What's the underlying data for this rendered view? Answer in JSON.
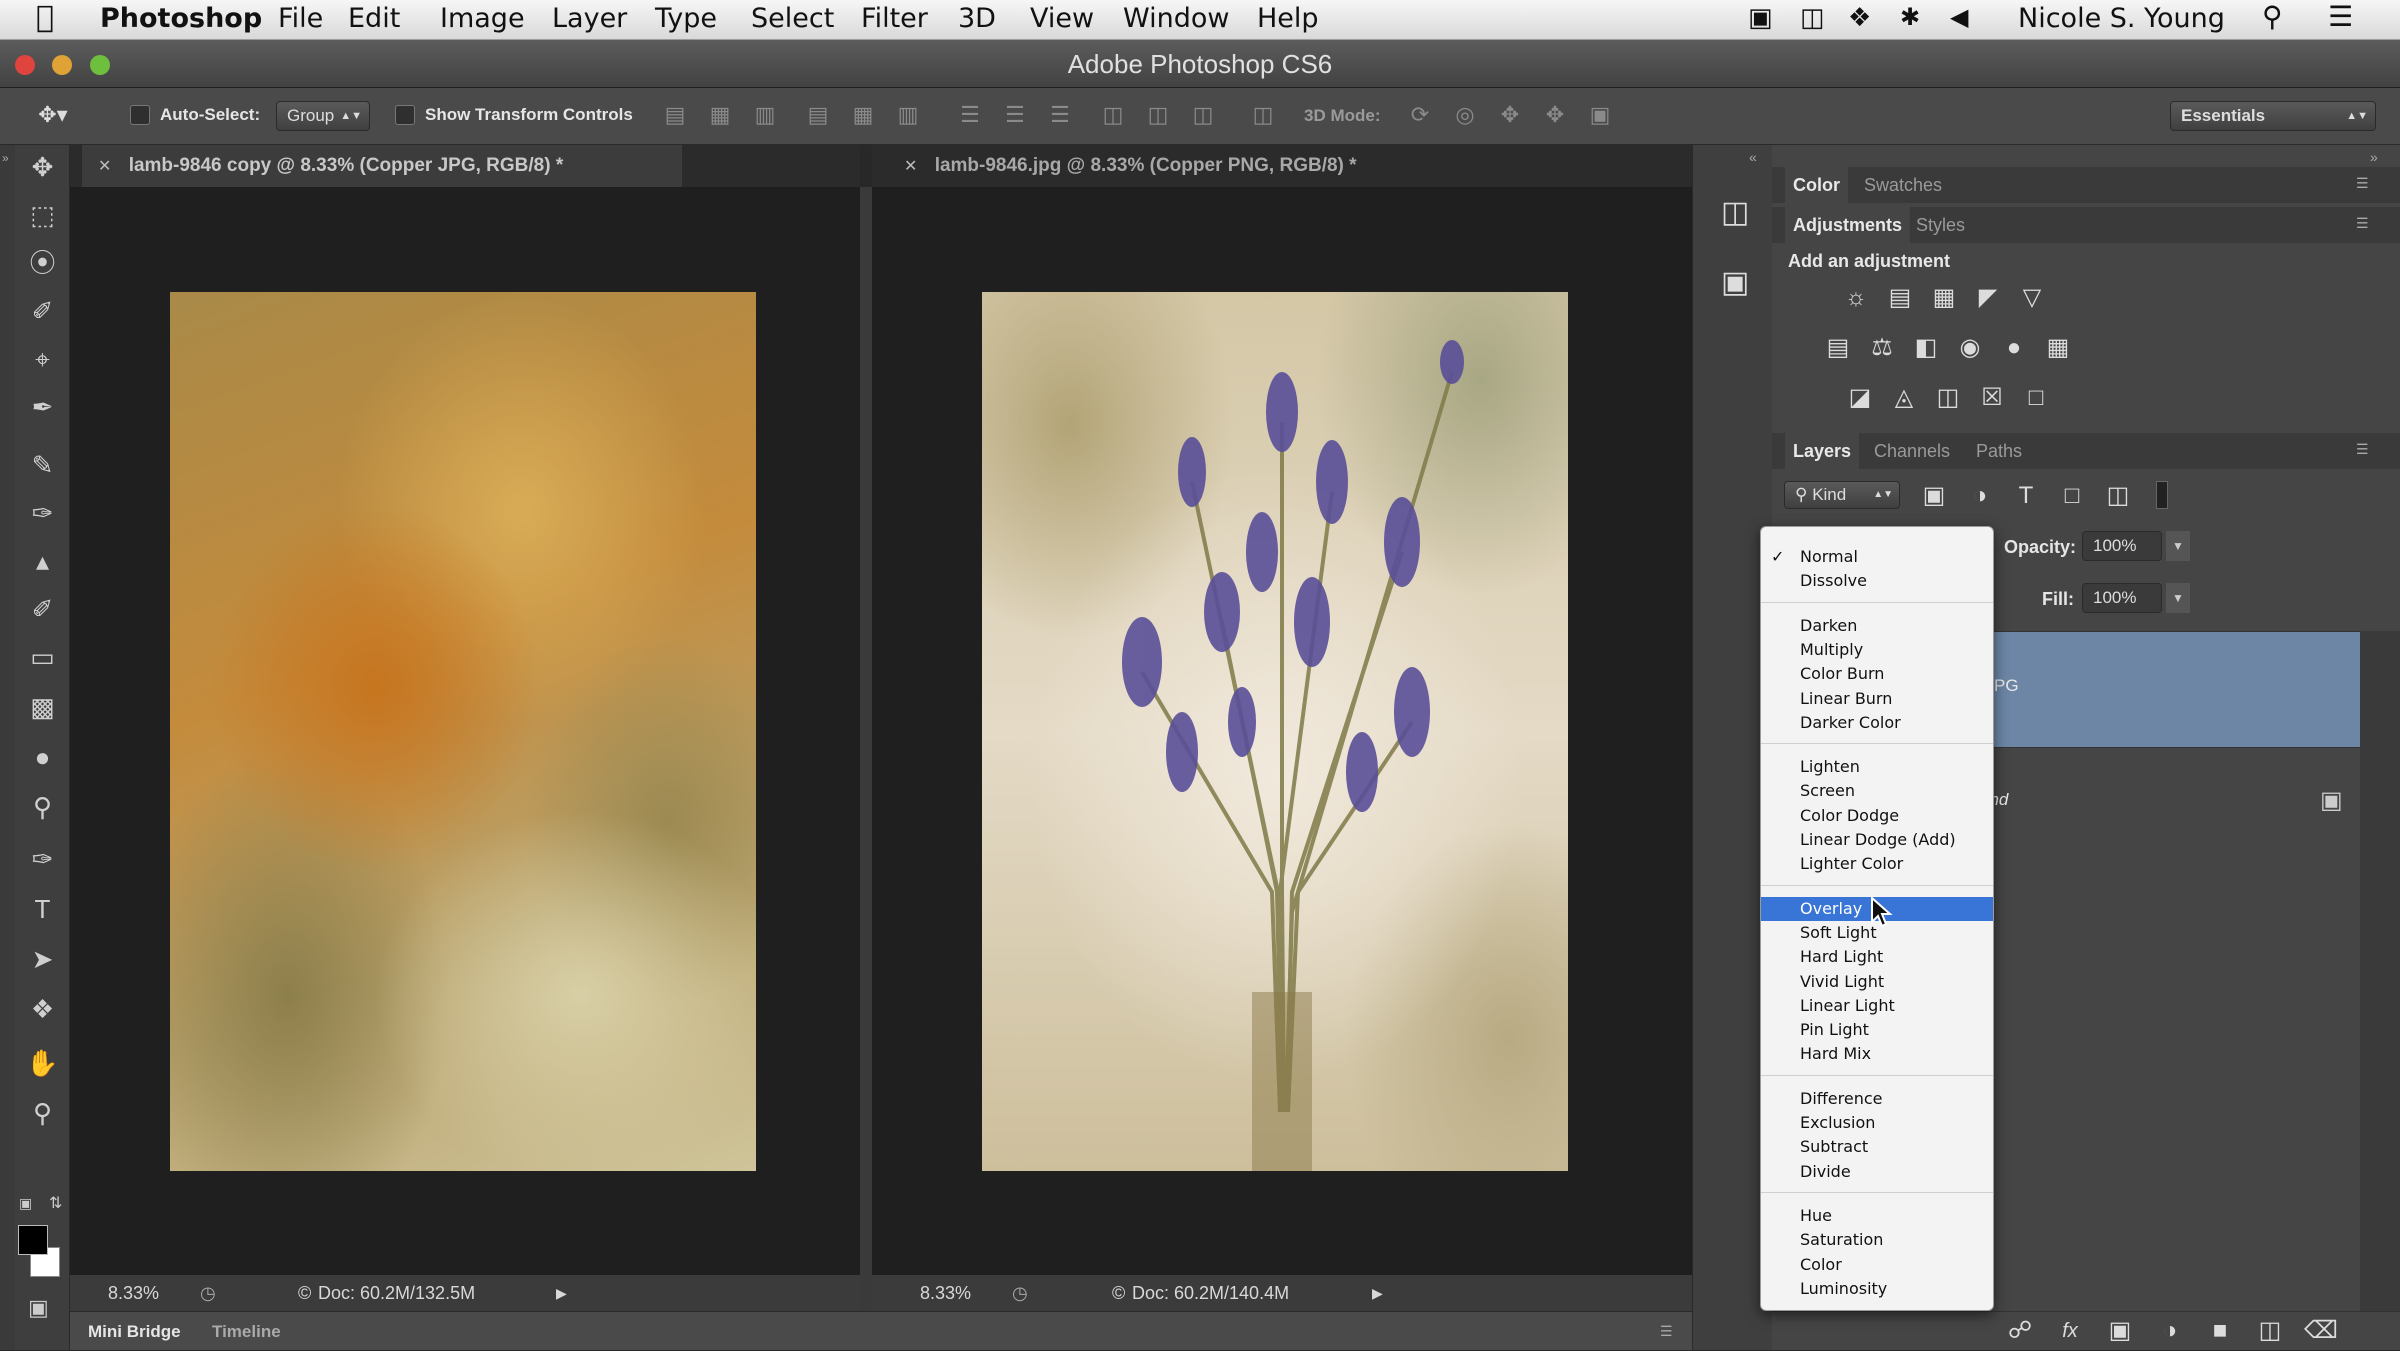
{
  "menubar": {
    "app": "Photoshop",
    "items": [
      "File",
      "Edit",
      "Image",
      "Layer",
      "Type",
      "Select",
      "Filter",
      "3D",
      "View",
      "Window",
      "Help"
    ],
    "user": "Nicole S. Young"
  },
  "window": {
    "title": "Adobe Photoshop CS6"
  },
  "options": {
    "auto_select_label": "Auto-Select:",
    "auto_select_value": "Group",
    "show_transform_label": "Show Transform Controls",
    "mode_3d_label": "3D Mode:",
    "workspace": "Essentials"
  },
  "docs": [
    {
      "tab": "lamb-9846 copy @ 8.33% (Copper JPG, RGB/8) *",
      "zoom": "8.33%",
      "doc": "Doc: 60.2M/132.5M"
    },
    {
      "tab": "lamb-9846.jpg @ 8.33% (Copper PNG, RGB/8) *",
      "zoom": "8.33%",
      "doc": "Doc: 60.2M/140.4M"
    }
  ],
  "bottom_tabs": [
    "Mini Bridge",
    "Timeline"
  ],
  "panels": {
    "color_tabs": [
      "Color",
      "Swatches"
    ],
    "adj_tabs": [
      "Adjustments",
      "Styles"
    ],
    "add_adjustment": "Add an adjustment",
    "layer_tabs": [
      "Layers",
      "Channels",
      "Paths"
    ],
    "kind": "Kind",
    "opacity_label": "Opacity:",
    "opacity_value": "100%",
    "fill_label": "Fill:",
    "fill_value": "100%",
    "layer1_suffix": "PG",
    "layer2_suffix": "und"
  },
  "blend_menu": {
    "checked": "Normal",
    "highlighted": "Overlay",
    "groups": [
      [
        "Normal",
        "Dissolve"
      ],
      [
        "Darken",
        "Multiply",
        "Color Burn",
        "Linear Burn",
        "Darker Color"
      ],
      [
        "Lighten",
        "Screen",
        "Color Dodge",
        "Linear Dodge (Add)",
        "Lighter Color"
      ],
      [
        "Overlay",
        "Soft Light",
        "Hard Light",
        "Vivid Light",
        "Linear Light",
        "Pin Light",
        "Hard Mix"
      ],
      [
        "Difference",
        "Exclusion",
        "Subtract",
        "Divide"
      ],
      [
        "Hue",
        "Saturation",
        "Color",
        "Luminosity"
      ]
    ]
  },
  "icons": {
    "apple": "apple-icon",
    "move_tool": "move-tool-icon",
    "lock": "lock-icon"
  },
  "colors": {
    "highlight": "#3875d7",
    "layer_selected": "#6d86a6"
  }
}
